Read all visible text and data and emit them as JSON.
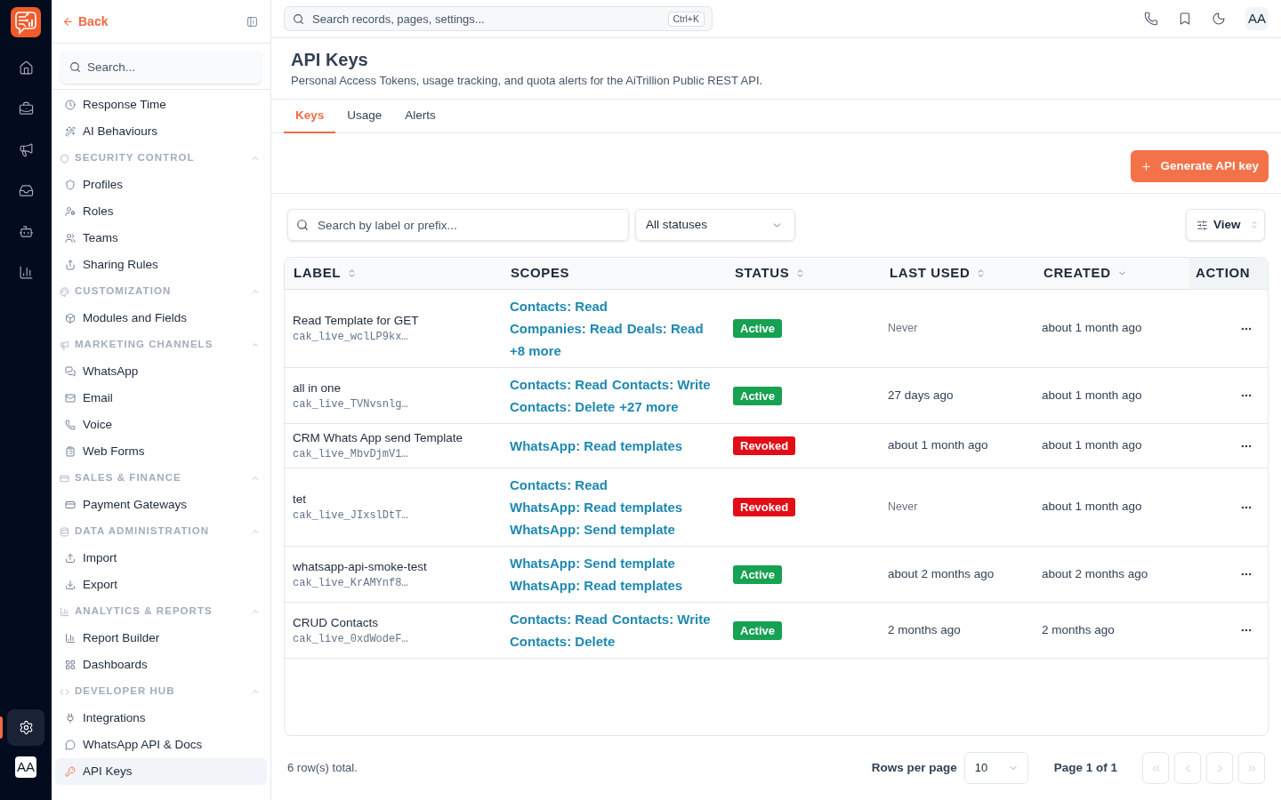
{
  "rail": {
    "items": [
      {
        "selected": false
      },
      {
        "selected": false
      },
      {
        "selected": false
      },
      {
        "selected": false
      },
      {
        "selected": false
      },
      {
        "selected": false
      }
    ],
    "settings": {
      "selected": true
    },
    "avatar": "AA"
  },
  "sidebar": {
    "back": "Back",
    "search": {
      "placeholder": "Search..."
    },
    "top_items": [
      {
        "label": "Response Time",
        "selected": false
      },
      {
        "label": "AI Behaviours",
        "selected": false
      }
    ],
    "sections": [
      {
        "title": "SECURITY CONTROL",
        "expanded": true,
        "items": [
          {
            "label": "Profiles",
            "selected": false
          },
          {
            "label": "Roles",
            "selected": false
          },
          {
            "label": "Teams",
            "selected": false
          },
          {
            "label": "Sharing Rules",
            "selected": false
          }
        ]
      },
      {
        "title": "CUSTOMIZATION",
        "expanded": true,
        "items": [
          {
            "label": "Modules and Fields",
            "selected": false
          }
        ]
      },
      {
        "title": "MARKETING CHANNELS",
        "expanded": true,
        "items": [
          {
            "label": "WhatsApp",
            "selected": false
          },
          {
            "label": "Email",
            "selected": false
          },
          {
            "label": "Voice",
            "selected": false
          },
          {
            "label": "Web Forms",
            "selected": false
          }
        ]
      },
      {
        "title": "SALES & FINANCE",
        "expanded": true,
        "items": [
          {
            "label": "Payment Gateways",
            "selected": false
          }
        ]
      },
      {
        "title": "DATA ADMINISTRATION",
        "expanded": true,
        "items": [
          {
            "label": "Import",
            "selected": false
          },
          {
            "label": "Export",
            "selected": false
          }
        ]
      },
      {
        "title": "ANALYTICS & REPORTS",
        "expanded": true,
        "items": [
          {
            "label": "Report Builder",
            "selected": false
          },
          {
            "label": "Dashboards",
            "selected": false
          }
        ]
      },
      {
        "title": "DEVELOPER HUB",
        "expanded": true,
        "items": [
          {
            "label": "Integrations",
            "selected": false
          },
          {
            "label": "WhatsApp API & Docs",
            "selected": false
          },
          {
            "label": "API Keys",
            "selected": true
          }
        ]
      }
    ]
  },
  "top_bar": {
    "search": {
      "placeholder": "Search records, pages, settings...",
      "shortcut": "Ctrl+K"
    },
    "avatar": "AA"
  },
  "page": {
    "title": "API Keys",
    "subtitle": "Personal Access Tokens, usage tracking, and quota alerts for the AiTrillion Public REST API."
  },
  "tabs": [
    {
      "label": "Keys",
      "selected": true
    },
    {
      "label": "Usage",
      "selected": false
    },
    {
      "label": "Alerts",
      "selected": false
    }
  ],
  "toolbar": {
    "primary_button": "Generate API key"
  },
  "filters": {
    "search": {
      "placeholder": "Search by label or prefix..."
    },
    "status_select": {
      "value": "All statuses"
    },
    "view_button": "View"
  },
  "table": {
    "columns": [
      {
        "label": "LABEL",
        "sortable": true,
        "sorted": false
      },
      {
        "label": "SCOPES",
        "sortable": false,
        "sorted": false
      },
      {
        "label": "STATUS",
        "sortable": true,
        "sorted": false
      },
      {
        "label": "LAST USED",
        "sortable": true,
        "sorted": false
      },
      {
        "label": "CREATED",
        "sortable": true,
        "sorted": true
      },
      {
        "label": "ACTION",
        "sortable": false,
        "sorted": false
      }
    ],
    "rows": [
      {
        "label": "Read Template for GET",
        "prefix": "cak_live_wclLP9kx…",
        "scope_lines": [
          [
            "Contacts: Read"
          ],
          [
            "Companies: Read",
            "Deals: Read"
          ],
          [
            "+8 more"
          ]
        ],
        "status": {
          "label": "Active",
          "kind": "active"
        },
        "last_used": {
          "text": "Never",
          "muted": true
        },
        "created": "about 1 month ago"
      },
      {
        "label": "all in one",
        "prefix": "cak_live_TVNvsnlg…",
        "scope_lines": [
          [
            "Contacts: Read",
            "Contacts: Write"
          ],
          [
            "Contacts: Delete",
            "+27 more"
          ]
        ],
        "status": {
          "label": "Active",
          "kind": "active"
        },
        "last_used": {
          "text": "27 days ago",
          "muted": false
        },
        "created": "about 1 month ago"
      },
      {
        "label": "CRM Whats App send Template",
        "prefix": "cak_live_MbvDjmV1…",
        "scope_lines": [
          [
            "WhatsApp: Read templates"
          ]
        ],
        "status": {
          "label": "Revoked",
          "kind": "revoked"
        },
        "last_used": {
          "text": "about 1 month ago",
          "muted": false
        },
        "created": "about 1 month ago"
      },
      {
        "label": "tet",
        "prefix": "cak_live_JIxslDtT…",
        "scope_lines": [
          [
            "Contacts: Read"
          ],
          [
            "WhatsApp: Read templates"
          ],
          [
            "WhatsApp: Send template"
          ]
        ],
        "status": {
          "label": "Revoked",
          "kind": "revoked"
        },
        "last_used": {
          "text": "Never",
          "muted": true
        },
        "created": "about 1 month ago"
      },
      {
        "label": "whatsapp-api-smoke-test",
        "prefix": "cak_live_KrAMYnf8…",
        "scope_lines": [
          [
            "WhatsApp: Send template"
          ],
          [
            "WhatsApp: Read templates"
          ]
        ],
        "status": {
          "label": "Active",
          "kind": "active"
        },
        "last_used": {
          "text": "about 2 months ago",
          "muted": false
        },
        "created": "about 2 months ago"
      },
      {
        "label": "CRUD Contacts",
        "prefix": "cak_live_0xdWodeF…",
        "scope_lines": [
          [
            "Contacts: Read",
            "Contacts: Write"
          ],
          [
            "Contacts: Delete"
          ]
        ],
        "status": {
          "label": "Active",
          "kind": "active"
        },
        "last_used": {
          "text": "2 months ago",
          "muted": false
        },
        "created": "2 months ago"
      }
    ]
  },
  "footer": {
    "total": "6 row(s) total.",
    "rows_per_page_label": "Rows per page",
    "rows_per_page": "10",
    "page": "Page 1 of 1",
    "pager": [
      {
        "disabled": true
      },
      {
        "disabled": true
      },
      {
        "disabled": true
      },
      {
        "disabled": true
      }
    ]
  }
}
